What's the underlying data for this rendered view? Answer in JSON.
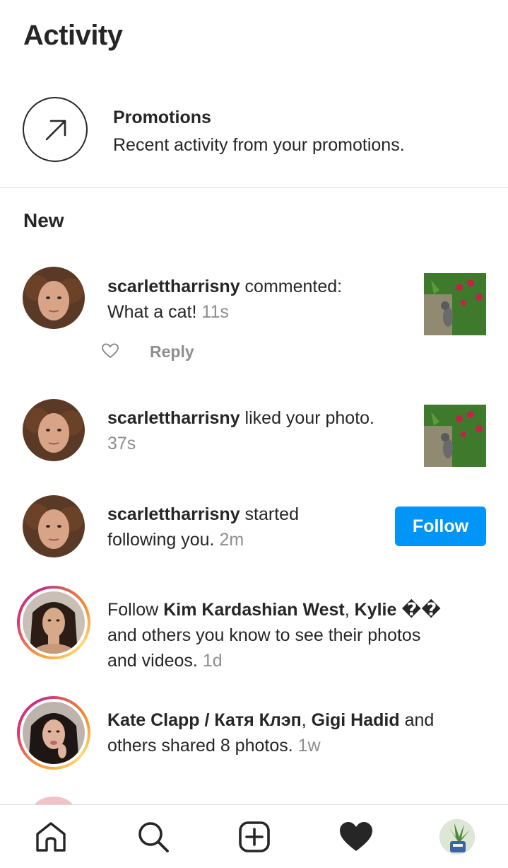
{
  "header": {
    "title": "Activity"
  },
  "promotions": {
    "icon": "arrow-up-right-icon",
    "title": "Promotions",
    "subtitle": "Recent activity from your promotions."
  },
  "section": {
    "new_label": "New"
  },
  "notifications": [
    {
      "username": "scarlettharrisny",
      "action": " commented:",
      "line2_text": "What a cat! ",
      "time": "11s",
      "actions": {
        "like_icon": "heart-outline-icon",
        "reply_label": "Reply"
      }
    },
    {
      "username": "scarlettharrisny",
      "action": " liked your photo.",
      "time": "37s"
    },
    {
      "username": "scarlettharrisny",
      "action": " started",
      "line2_text": "following you. ",
      "time": "2m",
      "button_label": "Follow"
    },
    {
      "prefix": "Follow ",
      "name1": "Kim Kardashian West",
      "sep": ", ",
      "name2": "Kylie",
      "glyphs": " ��",
      "line2_text": "and others you know to see their photos",
      "line3_text": "and videos. ",
      "time": "1d"
    },
    {
      "name1": "Kate Clapp / Катя Клэп",
      "sep": ", ",
      "name2": "Gigi Hadid",
      "suffix": " and",
      "line2_text": "others shared 8 photos. ",
      "time": "1w"
    }
  ],
  "nav": {
    "home_icon": "home-icon",
    "search_icon": "search-icon",
    "new_post_icon": "plus-square-icon",
    "activity_icon": "heart-filled-icon",
    "profile_icon": "profile-avatar"
  },
  "colors": {
    "accent": "#0095f6",
    "text": "#262626",
    "muted": "#8e8e8e",
    "divider": "#dbdbdb"
  }
}
